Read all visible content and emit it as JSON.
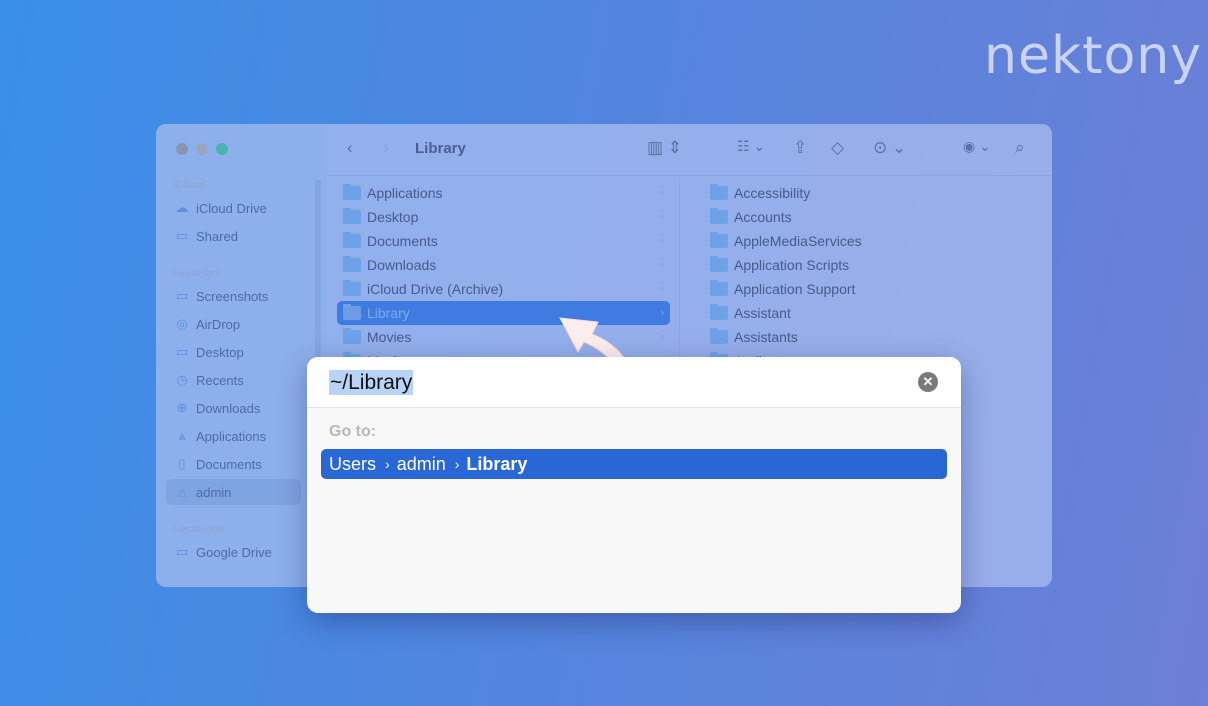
{
  "brand": {
    "logo": "nektony"
  },
  "finder": {
    "title": "Library",
    "sidebar": {
      "sections": [
        {
          "label": "iCloud",
          "items": [
            {
              "label": "iCloud Drive",
              "icon": "cloud-icon"
            },
            {
              "label": "Shared",
              "icon": "shared-folder-icon"
            }
          ]
        },
        {
          "label": "Favorites",
          "items": [
            {
              "label": "Screenshots",
              "icon": "folder-icon"
            },
            {
              "label": "AirDrop",
              "icon": "airdrop-icon"
            },
            {
              "label": "Desktop",
              "icon": "desktop-icon"
            },
            {
              "label": "Recents",
              "icon": "clock-icon"
            },
            {
              "label": "Downloads",
              "icon": "download-icon"
            },
            {
              "label": "Applications",
              "icon": "applications-icon"
            },
            {
              "label": "Documents",
              "icon": "document-icon"
            },
            {
              "label": "admin",
              "icon": "home-icon",
              "selected": true
            }
          ]
        },
        {
          "label": "Locations",
          "items": [
            {
              "label": "Google Drive",
              "icon": "folder-icon"
            }
          ]
        }
      ]
    },
    "column1": [
      "Applications",
      "Desktop",
      "Documents",
      "Downloads",
      "iCloud Drive (Archive)",
      "Library",
      "Movies",
      "Music"
    ],
    "column1_selected": "Library",
    "column2": [
      "Accessibility",
      "Accounts",
      "AppleMediaServices",
      "Application Scripts",
      "Application Support",
      "Assistant",
      "Assistants",
      "Audio"
    ]
  },
  "goto_dialog": {
    "input_value": "~/Library",
    "label": "Go to:",
    "suggestion": {
      "parts": [
        "Users",
        "admin"
      ],
      "last": "Library"
    }
  },
  "colors": {
    "accent": "#2966d6",
    "arrow": "#fdeeee"
  }
}
